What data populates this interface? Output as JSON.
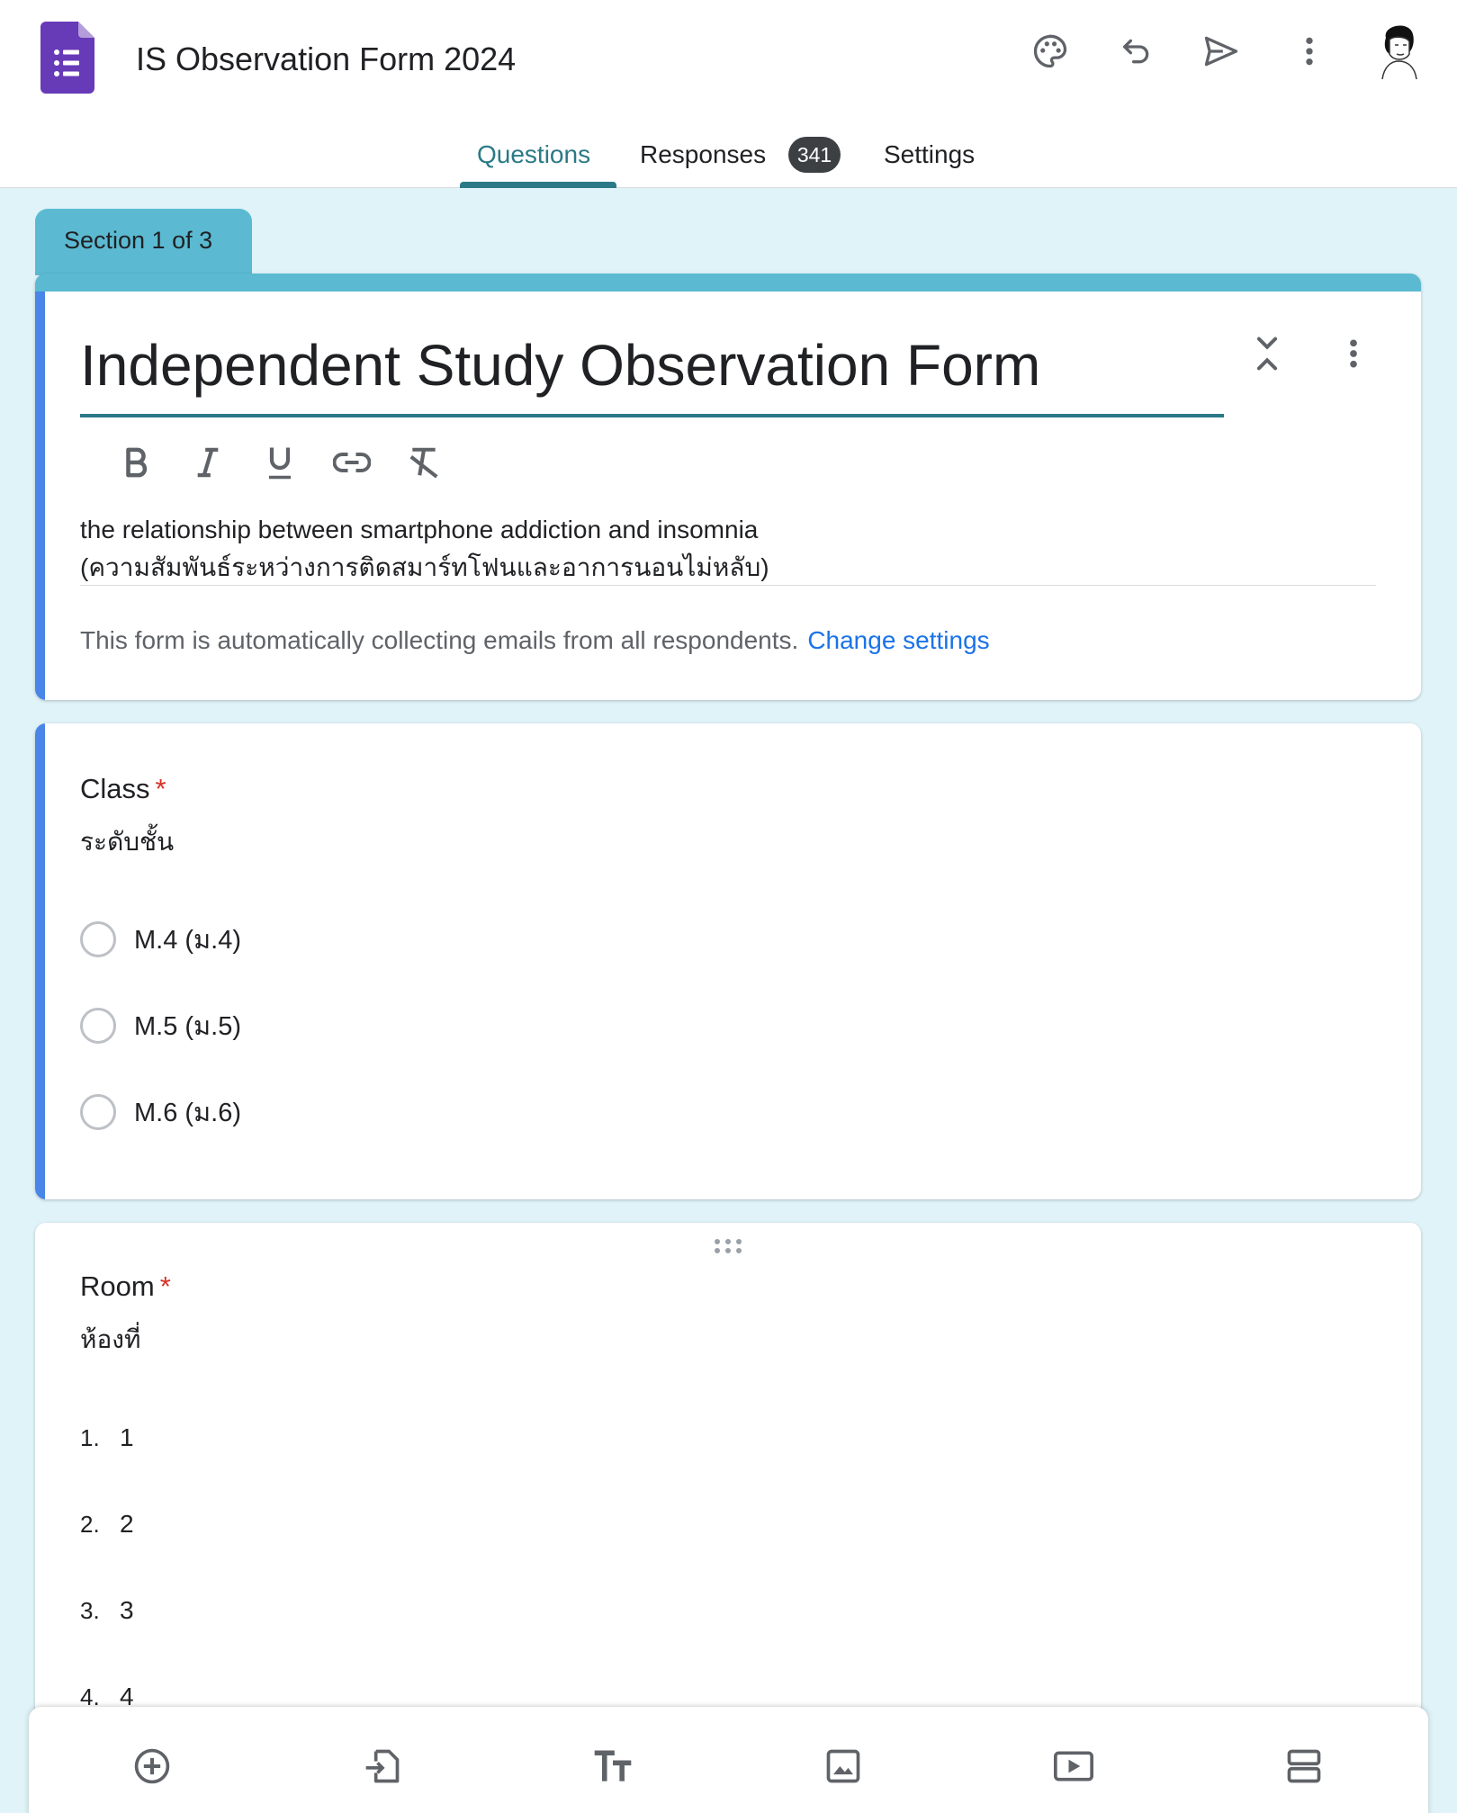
{
  "app": {
    "doc_title": "IS Observation Form 2024",
    "brand_color": "#673ab7",
    "accent_color": "#2b7987",
    "theme_color": "#5bbad2",
    "background_color": "#dff3f8"
  },
  "header_icons": [
    "palette-icon",
    "undo-icon",
    "send-icon",
    "more-vert-icon",
    "avatar"
  ],
  "tabs": {
    "questions": "Questions",
    "responses": "Responses",
    "responses_count": "341",
    "settings": "Settings"
  },
  "section": {
    "label": "Section 1 of 3"
  },
  "form": {
    "title": "Independent Study Observation Form",
    "description_line1": "the relationship between smartphone addiction and insomnia",
    "description_line2": "(ความสัมพันธ์ระหว่างการติดสมาร์ทโฟนและอาการนอนไม่หลับ)",
    "email_note": "This form is automatically collecting emails from all respondents.",
    "change_settings": "Change settings"
  },
  "format_toolbar": [
    "bold-icon",
    "italic-icon",
    "underline-icon",
    "link-icon",
    "clear-format-icon"
  ],
  "questions": [
    {
      "title": "Class",
      "required_mark": "*",
      "description": "ระดับชั้น",
      "options": [
        "M.4 (ม.4)",
        "M.5 (ม.5)",
        "M.6 (ม.6)"
      ]
    },
    {
      "title": "Room",
      "required_mark": "*",
      "description": "ห้องที่",
      "options": [
        {
          "num": "1.",
          "label": "1"
        },
        {
          "num": "2.",
          "label": "2"
        },
        {
          "num": "3.",
          "label": "3"
        },
        {
          "num": "4.",
          "label": "4"
        }
      ]
    }
  ],
  "bottom_toolbar": [
    "add-question-icon",
    "import-questions-icon",
    "add-title-icon",
    "add-image-icon",
    "add-video-icon",
    "add-section-icon"
  ]
}
